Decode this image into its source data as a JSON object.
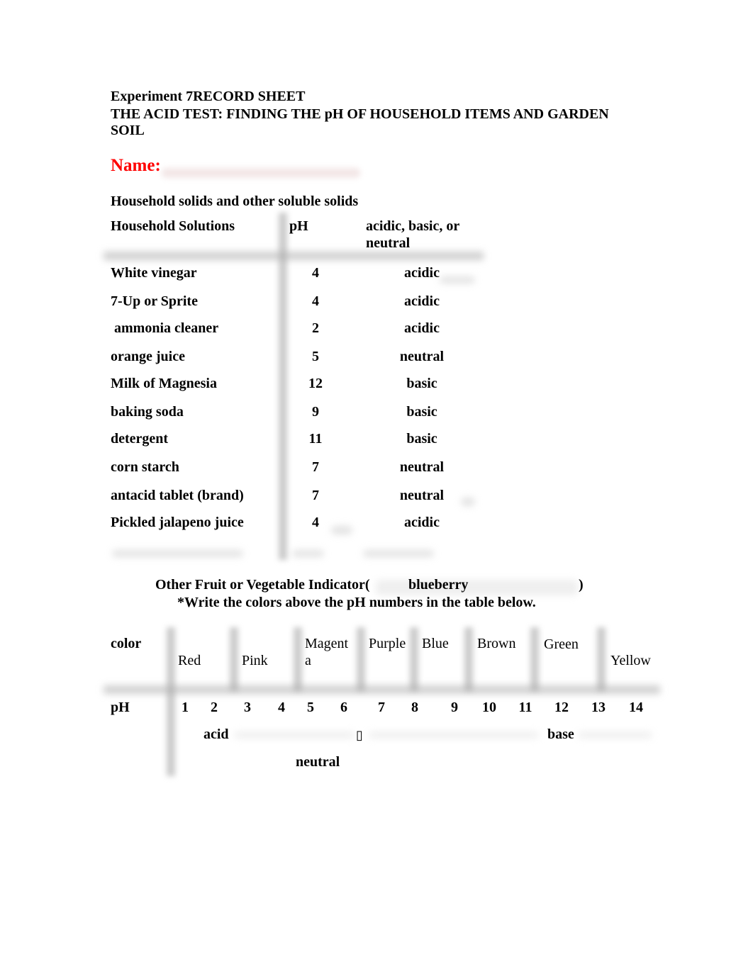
{
  "header": {
    "line1": "Experiment 7RECORD SHEET",
    "line2": "THE ACID TEST: FINDING THE pH OF HOUSEHOLD ITEMS AND GARDEN",
    "line3": "SOIL"
  },
  "name": {
    "label": "Name:",
    "value": "",
    "label_color": "#ff0000"
  },
  "household": {
    "section_title": "Household solids and other soluble solids",
    "columns": {
      "name": "Household Solutions",
      "ph": "pH",
      "class_line1": "acidic, basic, or",
      "class_line2": "neutral"
    },
    "rows": [
      {
        "name": "White vinegar",
        "ph": "4",
        "class": "acidic"
      },
      {
        "name": "7-Up or Sprite",
        "ph": "4",
        "class": "acidic"
      },
      {
        "name": " ammonia cleaner",
        "ph": "2",
        "class": "acidic"
      },
      {
        "name": "orange juice",
        "ph": "5",
        "class": "neutral"
      },
      {
        "name": "Milk of Magnesia",
        "ph": "12",
        "class": "basic"
      },
      {
        "name": "baking soda",
        "ph": "9",
        "class": "basic"
      },
      {
        "name": "detergent",
        "ph": "11",
        "class": "basic"
      },
      {
        "name": "corn starch",
        "ph": "7",
        "class": "neutral"
      },
      {
        "name": "antacid tablet (brand)",
        "ph": "7",
        "class": "neutral"
      },
      {
        "name": "Pickled jalapeno juice",
        "ph": "4",
        "class": "acidic"
      }
    ]
  },
  "indicator": {
    "label": "Other Fruit or Vegetable Indicator(",
    "value": "blueberry",
    "close": ")",
    "instruction": "*Write the colors above the pH numbers in the table below."
  },
  "scale": {
    "color_label": "color",
    "ph_label": "pH",
    "colors": [
      {
        "text": "Red",
        "bold": true
      },
      {
        "text": "Pink",
        "bold": false
      },
      {
        "text": "Magent",
        "bold": false
      },
      {
        "text": "a",
        "bold": false
      },
      {
        "text": "Purple",
        "bold": false
      },
      {
        "text": "Blue",
        "bold": false
      },
      {
        "text": "Brown",
        "bold": false
      },
      {
        "text": "Green",
        "bold": false
      },
      {
        "text": "Yellow",
        "bold": false
      }
    ],
    "ph_values": [
      "1",
      "2",
      "3",
      "4",
      "5",
      "6",
      "7",
      "8",
      "9",
      "10",
      "11",
      "12",
      "13",
      "14"
    ],
    "acid_label": "acid",
    "base_label": "base",
    "neutral_label": "neutral",
    "neutral_marker": "▯"
  }
}
